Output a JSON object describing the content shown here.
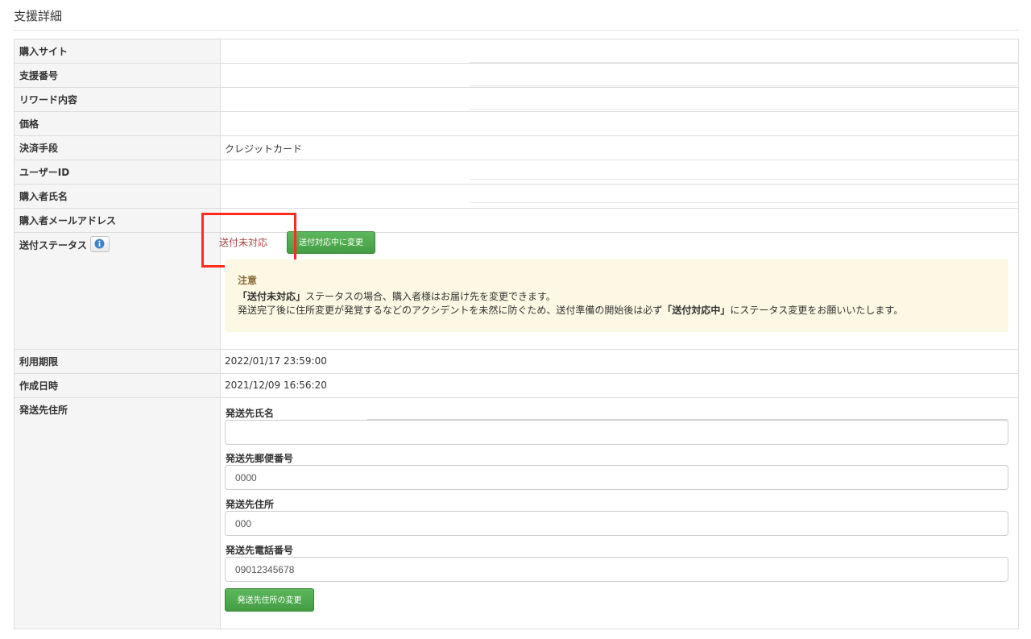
{
  "page": {
    "title": "支援詳細"
  },
  "rows": {
    "purchase_site": {
      "label": "購入サイト",
      "value": ""
    },
    "support_number": {
      "label": "支援番号",
      "value": ""
    },
    "reward_content": {
      "label": "リワード内容",
      "value": ""
    },
    "price": {
      "label": "価格",
      "value": ""
    },
    "payment_method": {
      "label": "決済手段",
      "value": "クレジットカード"
    },
    "user_id": {
      "label": "ユーザーID",
      "value": ""
    },
    "buyer_name": {
      "label": "購入者氏名",
      "value": ""
    },
    "buyer_email": {
      "label": "購入者メールアドレス",
      "value": ""
    },
    "shipping_status": {
      "label": "送付ステータス",
      "value": "送付未対応",
      "button_label": "送付対応中に変更",
      "icon": "info-icon"
    },
    "expiry": {
      "label": "利用期限",
      "value": "2022/01/17 23:59:00"
    },
    "created_at": {
      "label": "作成日時",
      "value": "2021/12/09 16:56:20"
    },
    "shipping_address": {
      "label": "発送先住所"
    }
  },
  "notice": {
    "heading": "注意",
    "line1_bold": "「送付未対応」",
    "line1_rest": "ステータスの場合、購入者様はお届け先を変更できます。",
    "line2_start": "発送完了後に住所変更が発覚するなどのアクシデントを未然に防ぐため、送付準備の開始後は必ず",
    "line2_bold": "「送付対応中」",
    "line2_end": "にステータス変更をお願いいたします。"
  },
  "address_form": {
    "name_label": "発送先氏名",
    "name_value": "",
    "postal_label": "発送先郵便番号",
    "postal_value": "0000",
    "address_label": "発送先住所",
    "address_value": "000",
    "phone_label": "発送先電話番号",
    "phone_value": "09012345678",
    "submit_label": "発送先住所の変更"
  },
  "colors": {
    "status_text": "#a94442",
    "button_green": "#5cb85c",
    "notice_bg": "#fcf8e3",
    "highlight": "#ff2d1b"
  }
}
